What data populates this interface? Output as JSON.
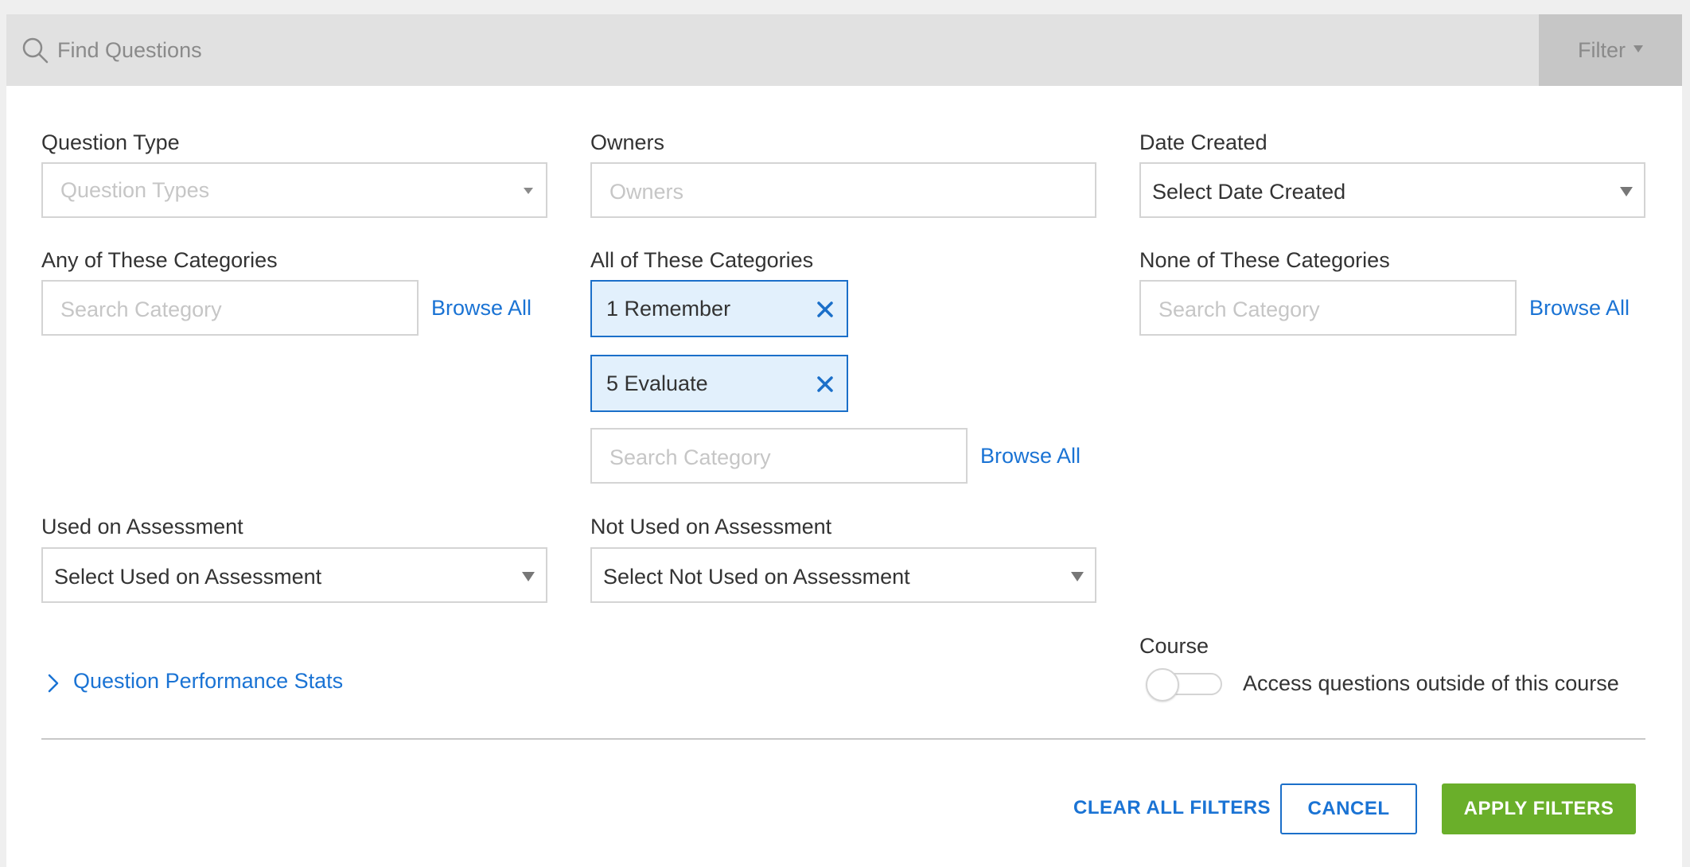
{
  "search": {
    "placeholder": "Find Questions",
    "filter_label": "Filter"
  },
  "question_type": {
    "label": "Question Type",
    "placeholder": "Question Types"
  },
  "owners": {
    "label": "Owners",
    "placeholder": "Owners"
  },
  "date_created": {
    "label": "Date Created",
    "value": "Select Date Created"
  },
  "any_categories": {
    "label": "Any of These Categories",
    "placeholder": "Search Category",
    "browse": "Browse All"
  },
  "all_categories": {
    "label": "All of These Categories",
    "chips": [
      "1 Remember",
      "5 Evaluate"
    ],
    "placeholder": "Search Category",
    "browse": "Browse All"
  },
  "none_categories": {
    "label": "None of These Categories",
    "placeholder": "Search Category",
    "browse": "Browse All"
  },
  "used_on_assessment": {
    "label": "Used on Assessment",
    "value": "Select Used on Assessment"
  },
  "not_used_on_assessment": {
    "label": "Not Used on Assessment",
    "value": "Select Not Used on Assessment"
  },
  "performance_stats": {
    "label": "Question Performance Stats"
  },
  "course": {
    "label": "Course",
    "toggle_label": "Access questions outside of this course",
    "toggle_on": false
  },
  "actions": {
    "clear": "CLEAR ALL FILTERS",
    "cancel": "CANCEL",
    "apply": "APPLY FILTERS"
  },
  "colors": {
    "accent": "#1a73d4",
    "apply": "#6aaf2a",
    "chip_bg": "#e2f0fc",
    "search_bar": "#e1e1e1"
  },
  "icons": {
    "search": "search-icon",
    "filter_caret": "caret-down-icon",
    "chip_remove": "close-icon",
    "expand": "chevron-right-icon"
  }
}
